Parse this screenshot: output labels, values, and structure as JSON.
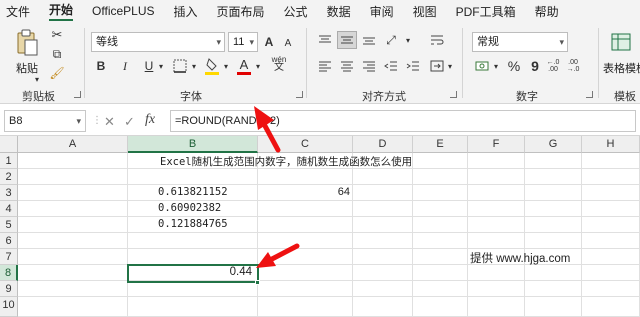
{
  "menu": {
    "items": [
      "文件",
      "开始",
      "OfficePLUS",
      "插入",
      "页面布局",
      "公式",
      "数据",
      "审阅",
      "视图",
      "PDF工具箱",
      "帮助"
    ],
    "active": "开始"
  },
  "ribbon": {
    "clipboard": {
      "paste": "粘贴",
      "label": "剪贴板"
    },
    "font": {
      "name": "等线",
      "size": "11",
      "label": "字体",
      "bold": "B",
      "italic": "I",
      "underline": "U",
      "grow": "A",
      "shrink": "A",
      "fontcolor": "A",
      "wen": "wén"
    },
    "alignment": {
      "label": "对齐方式"
    },
    "number": {
      "format": "常规",
      "label": "数字",
      "percent": "%",
      "comma": "9",
      "dec_inc": "←.0 .00",
      "dec_dec": ".00 →.0"
    },
    "templates": {
      "label": "表格模板",
      "sub": "模板"
    },
    "colors": {
      "accent": "#217346",
      "fill_yellow": "#ffd800",
      "font_red": "#e00000"
    }
  },
  "formula_bar": {
    "name_box": "B8",
    "cancel": "✕",
    "enter": "✓",
    "fx": "fx",
    "formula": "=ROUND(RAND(), 2)"
  },
  "sheet": {
    "columns": [
      "A",
      "B",
      "C",
      "D",
      "E",
      "F",
      "G",
      "H"
    ],
    "rows": [
      "1",
      "2",
      "3",
      "4",
      "5",
      "6",
      "7",
      "8",
      "9",
      "10"
    ],
    "title": "Excel随机生成范围内数字，随机数生成函数怎么使用",
    "b3": "0.613821152",
    "b4": "0.60902382",
    "b5": "0.121884765",
    "c3": "64",
    "b8": "0.44",
    "credit": "提供 www.hjga.com",
    "selected_cell": "B8"
  }
}
